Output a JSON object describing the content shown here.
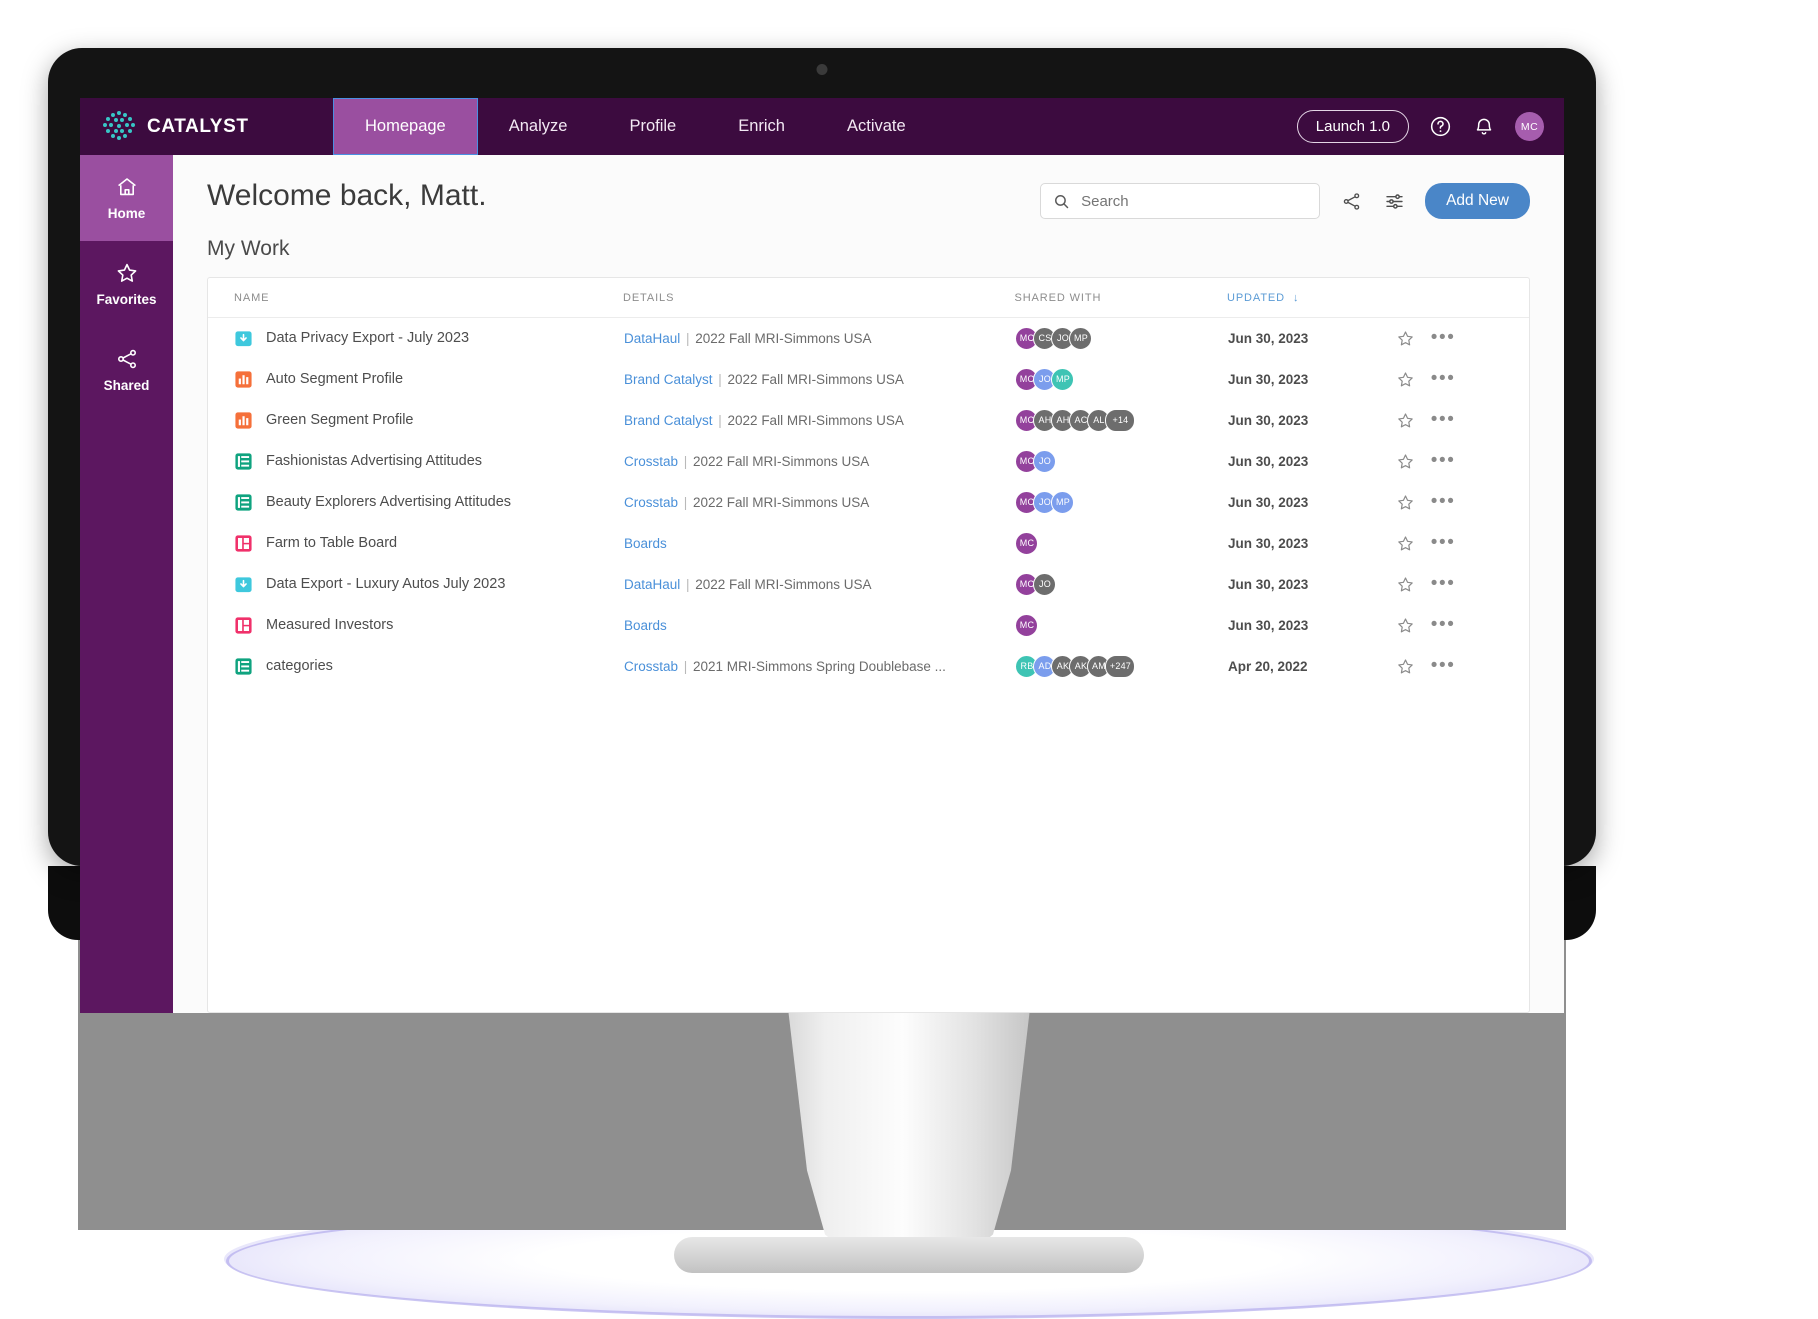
{
  "app": {
    "brand": "CATALYST",
    "nav": [
      {
        "label": "Homepage",
        "active": true
      },
      {
        "label": "Analyze",
        "active": false
      },
      {
        "label": "Profile",
        "active": false
      },
      {
        "label": "Enrich",
        "active": false
      },
      {
        "label": "Activate",
        "active": false
      }
    ],
    "launch_button": "Launch 1.0",
    "help_icon": "help-circle-icon",
    "bell_icon": "bell-icon",
    "user_initials": "MC"
  },
  "sidebar": {
    "items": [
      {
        "label": "Home",
        "icon": "home-icon",
        "active": true
      },
      {
        "label": "Favorites",
        "icon": "star-icon",
        "active": false
      },
      {
        "label": "Shared",
        "icon": "share-icon",
        "active": false
      }
    ]
  },
  "header": {
    "welcome": "Welcome back, Matt.",
    "section_title": "My Work",
    "search_placeholder": "Search",
    "search_value": "",
    "search_icon": "search-icon",
    "share_icon": "share-icon",
    "filter_icon": "sliders-icon",
    "add_new_label": "Add New"
  },
  "table": {
    "columns": [
      "NAME",
      "DETAILS",
      "SHARED WITH",
      "UPDATED"
    ],
    "sort_column": "UPDATED",
    "sort_direction": "desc",
    "rows": [
      {
        "name": "Data Privacy Export - July 2023",
        "icon": "download-file-icon",
        "icon_color": "#3ec8dd",
        "detail_link": "DataHaul",
        "detail_rest": "2022 Fall MRI-Simmons USA",
        "shared": [
          {
            "initials": "MC",
            "color": "#93419c"
          },
          {
            "initials": "CS",
            "color": "#6d6d6d"
          },
          {
            "initials": "JO",
            "color": "#6d6d6d"
          },
          {
            "initials": "MP",
            "color": "#6d6d6d"
          }
        ],
        "updated": "Jun 30, 2023"
      },
      {
        "name": "Auto Segment Profile",
        "icon": "bar-chart-icon",
        "icon_color": "#f5703a",
        "detail_link": "Brand Catalyst",
        "detail_rest": "2022 Fall MRI-Simmons USA",
        "shared": [
          {
            "initials": "MC",
            "color": "#93419c"
          },
          {
            "initials": "JO",
            "color": "#7b9ded"
          },
          {
            "initials": "MP",
            "color": "#3ec4b4"
          }
        ],
        "updated": "Jun 30, 2023"
      },
      {
        "name": "Green Segment Profile",
        "icon": "bar-chart-icon",
        "icon_color": "#f5703a",
        "detail_link": "Brand Catalyst",
        "detail_rest": "2022 Fall MRI-Simmons USA",
        "shared": [
          {
            "initials": "MC",
            "color": "#93419c"
          },
          {
            "initials": "AH",
            "color": "#6d6d6d"
          },
          {
            "initials": "AH",
            "color": "#6d6d6d"
          },
          {
            "initials": "AC",
            "color": "#6d6d6d"
          },
          {
            "initials": "AL",
            "color": "#6d6d6d"
          },
          {
            "initials": "+14",
            "color": "#6d6d6d",
            "wide": true
          }
        ],
        "updated": "Jun 30, 2023"
      },
      {
        "name": "Fashionistas Advertising Attitudes",
        "icon": "crosstab-icon",
        "icon_color": "#0fa37f",
        "detail_link": "Crosstab",
        "detail_rest": "2022 Fall MRI-Simmons USA",
        "shared": [
          {
            "initials": "MC",
            "color": "#93419c"
          },
          {
            "initials": "JO",
            "color": "#7b9ded"
          }
        ],
        "updated": "Jun 30, 2023"
      },
      {
        "name": "Beauty Explorers Advertising Attitudes",
        "icon": "crosstab-icon",
        "icon_color": "#0fa37f",
        "detail_link": "Crosstab",
        "detail_rest": "2022 Fall MRI-Simmons USA",
        "shared": [
          {
            "initials": "MC",
            "color": "#93419c"
          },
          {
            "initials": "JO",
            "color": "#7b9ded"
          },
          {
            "initials": "MP",
            "color": "#7b9ded"
          }
        ],
        "updated": "Jun 30, 2023"
      },
      {
        "name": "Farm to Table Board",
        "icon": "board-icon",
        "icon_color": "#f0306a",
        "detail_link": "Boards",
        "detail_rest": "",
        "shared": [
          {
            "initials": "MC",
            "color": "#93419c"
          }
        ],
        "updated": "Jun 30, 2023"
      },
      {
        "name": "Data Export - Luxury Autos July 2023",
        "icon": "download-file-icon",
        "icon_color": "#3ec8dd",
        "detail_link": "DataHaul",
        "detail_rest": "2022 Fall MRI-Simmons USA",
        "shared": [
          {
            "initials": "MC",
            "color": "#93419c"
          },
          {
            "initials": "JO",
            "color": "#6d6d6d"
          }
        ],
        "updated": "Jun 30, 2023"
      },
      {
        "name": "Measured Investors",
        "icon": "board-icon",
        "icon_color": "#f0306a",
        "detail_link": "Boards",
        "detail_rest": "",
        "shared": [
          {
            "initials": "MC",
            "color": "#93419c"
          }
        ],
        "updated": "Jun 30, 2023"
      },
      {
        "name": "categories",
        "icon": "crosstab-icon",
        "icon_color": "#0fa37f",
        "detail_link": "Crosstab",
        "detail_rest": "2021 MRI-Simmons Spring Doublebase ...",
        "shared": [
          {
            "initials": "RB",
            "color": "#3ec4b4"
          },
          {
            "initials": "AD",
            "color": "#7b9ded"
          },
          {
            "initials": "AK",
            "color": "#6d6d6d"
          },
          {
            "initials": "AK",
            "color": "#6d6d6d"
          },
          {
            "initials": "AM",
            "color": "#6d6d6d"
          },
          {
            "initials": "+247",
            "color": "#6d6d6d",
            "wide": true
          }
        ],
        "updated": "Apr 20, 2022"
      }
    ],
    "row_actions": {
      "favorite_icon": "star-outline-icon",
      "more_icon": "more-horizontal-icon"
    }
  },
  "colors": {
    "topbar": "#3c0b3f",
    "sidebar": "#5c1760",
    "active_purple": "#9a4fa0",
    "accent_blue": "#4a86c8",
    "link_blue": "#4a90d9",
    "logo_teal": "#38c6c6"
  }
}
